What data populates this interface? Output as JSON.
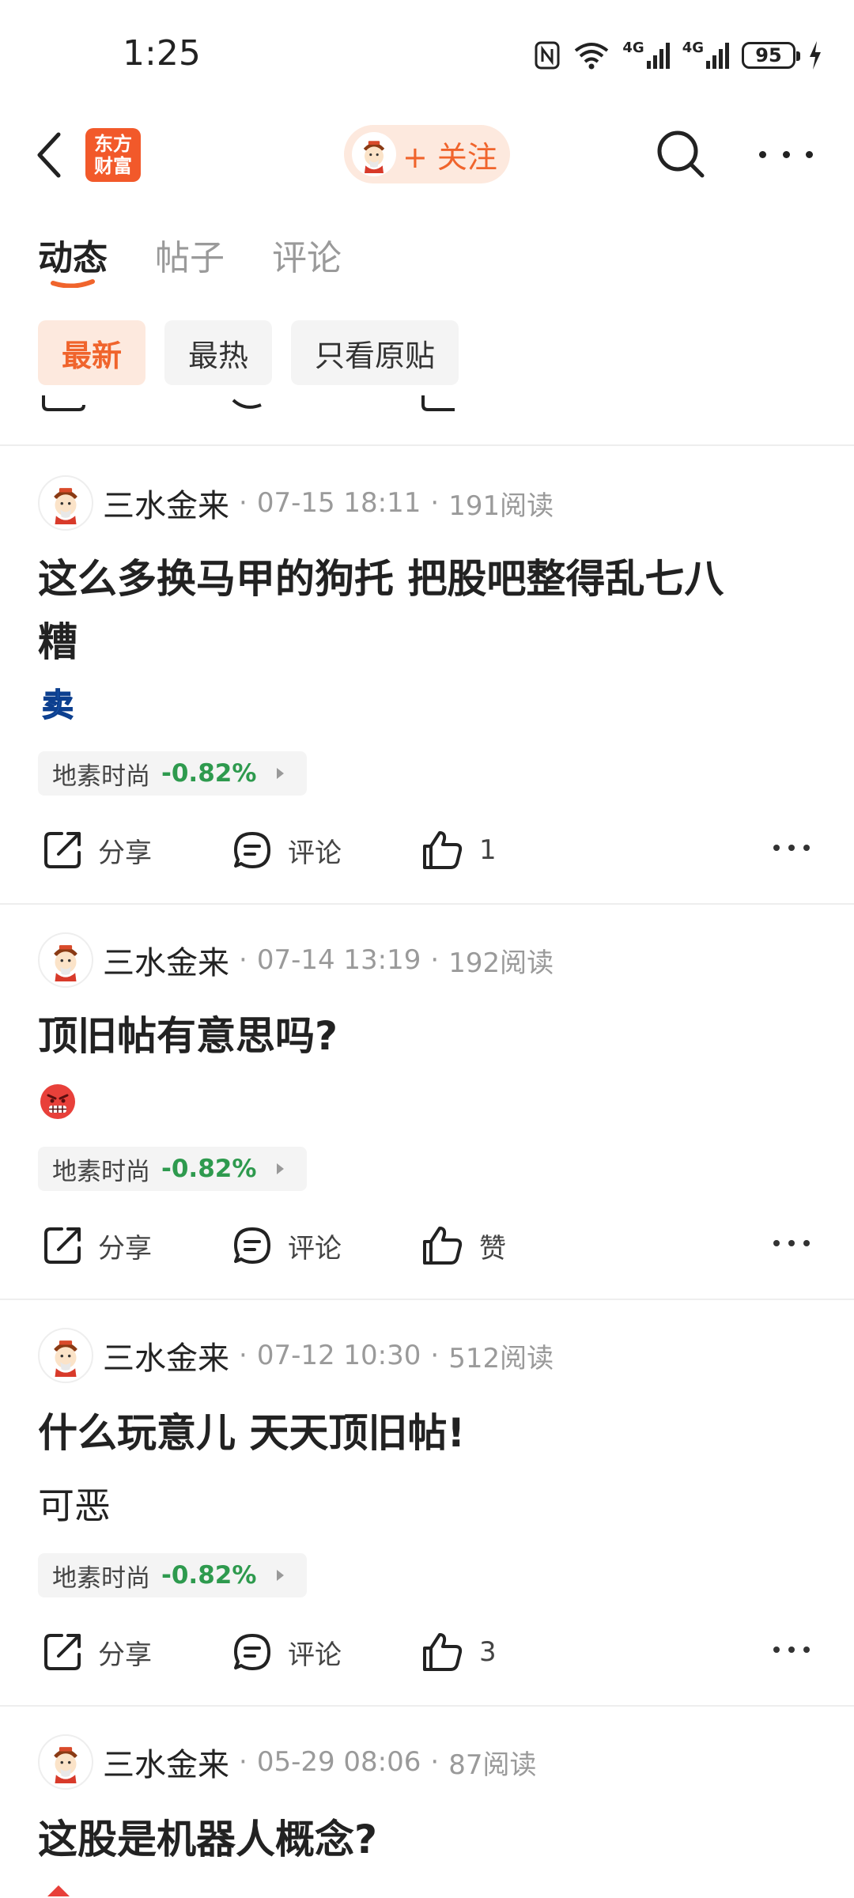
{
  "status_bar": {
    "time": "1:25",
    "battery": "95",
    "net1": "4G",
    "net2": "4G"
  },
  "nav": {
    "logo_line1": "东方",
    "logo_line2": "财富",
    "follow_label": "+ 关注"
  },
  "tabs": [
    {
      "label": "动态"
    },
    {
      "label": "帖子"
    },
    {
      "label": "评论"
    }
  ],
  "filters": [
    {
      "label": "最新"
    },
    {
      "label": "最热"
    },
    {
      "label": "只看原贴"
    }
  ],
  "posts": [
    {
      "author": "三水金来",
      "datetime": "07-15 18:11",
      "reads": "191阅读",
      "title_line1": "这么多换马甲的狗托 把股吧整得乱七八",
      "title_line2": "糟",
      "emoji": "sell-emoji",
      "emoji_text": "卖",
      "stock": {
        "name": "地素时尚",
        "change": "-0.82%"
      },
      "share": "分享",
      "comment": "评论",
      "like": "1"
    },
    {
      "author": "三水金来",
      "datetime": "07-14 13:19",
      "reads": "192阅读",
      "title_line1": "顶旧帖有意思吗?",
      "emoji": "angry-face-emoji",
      "stock": {
        "name": "地素时尚",
        "change": "-0.82%"
      },
      "share": "分享",
      "comment": "评论",
      "like": "赞"
    },
    {
      "author": "三水金来",
      "datetime": "07-12 10:30",
      "reads": "512阅读",
      "title_line1": "什么玩意儿 天天顶旧帖!",
      "body": "可恶",
      "stock": {
        "name": "地素时尚",
        "change": "-0.82%"
      },
      "share": "分享",
      "comment": "评论",
      "like": "3"
    },
    {
      "author": "三水金来",
      "datetime": "05-29 08:06",
      "reads": "87阅读",
      "title_line1": "这股是机器人概念?"
    }
  ],
  "colors": {
    "accent": "#f0642c",
    "accent_bg": "#fde9de",
    "down_green": "#2e9a4e",
    "logo": "#f2592a"
  }
}
